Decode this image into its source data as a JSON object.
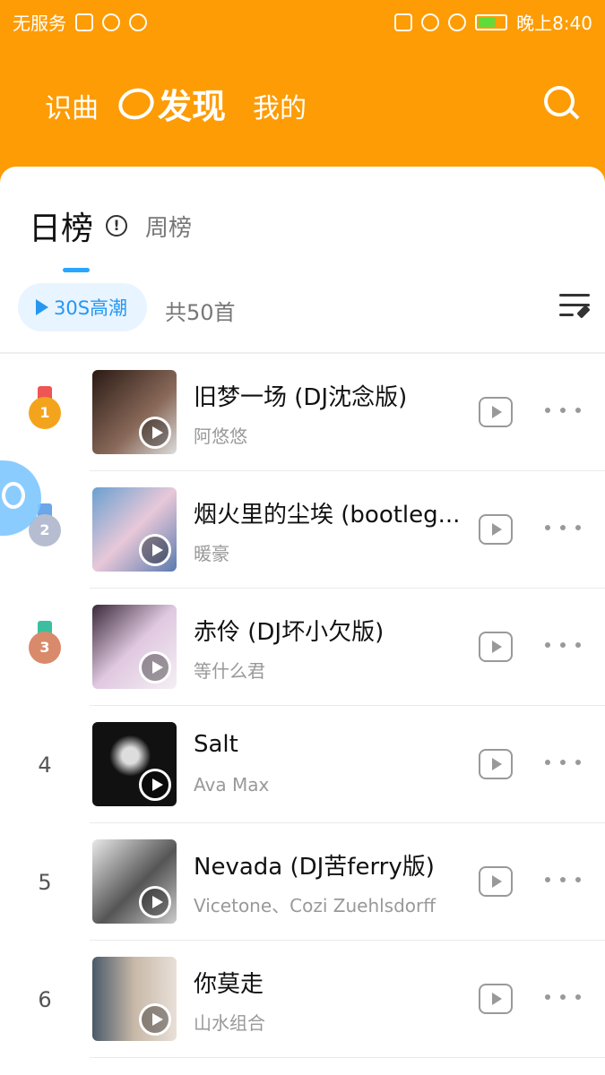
{
  "status": {
    "carrier": "无服务",
    "time": "晚上8:40"
  },
  "nav": {
    "recognize": "识曲",
    "discover": "发现",
    "mine": "我的"
  },
  "tabs": {
    "daily": "日榜",
    "weekly": "周榜"
  },
  "filter": {
    "hot_label": "30S高潮",
    "count": "共50首"
  },
  "songs": [
    {
      "rank": "1",
      "title": "旧梦一场 (DJ沈念版)",
      "artist": "阿悠悠",
      "cover_color": "#5a3e34"
    },
    {
      "rank": "2",
      "title": "烟火里的尘埃 (bootleg...",
      "artist": "暖豪",
      "cover_color": "#8fb8d8"
    },
    {
      "rank": "3",
      "title": "赤伶 (DJ坏小欠版)",
      "artist": "等什么君",
      "cover_color": "#c9a8c8"
    },
    {
      "rank": "4",
      "title": "Salt",
      "artist": "Ava Max",
      "cover_color": "#111111"
    },
    {
      "rank": "5",
      "title": "Nevada (DJ苦ferry版)",
      "artist": "Vicetone、Cozi Zuehlsdorff",
      "cover_color": "#9a9a9a"
    },
    {
      "rank": "6",
      "title": "你莫走",
      "artist": "山水组合",
      "cover_color": "#7a8a9c"
    }
  ],
  "colors": {
    "brand": "#fd9c05",
    "accent": "#29a6ff"
  }
}
